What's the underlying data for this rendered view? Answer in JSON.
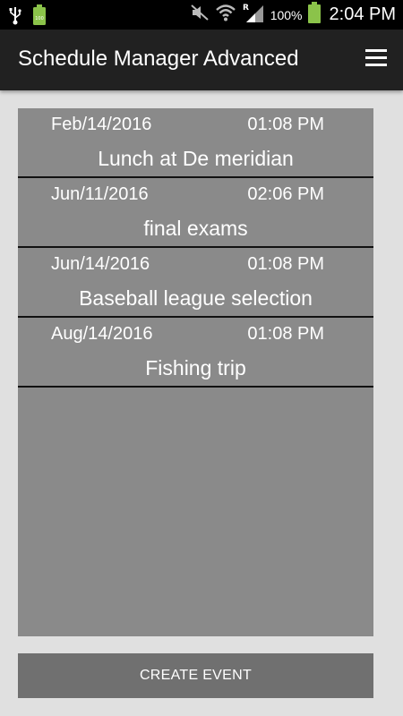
{
  "status_bar": {
    "battery_percent": "100%",
    "time": "2:04 PM",
    "icons": [
      "usb-icon",
      "battery-notification-icon",
      "mute-icon",
      "wifi-icon",
      "signal-icon",
      "battery-icon"
    ],
    "battery_color": "#8bc34a"
  },
  "app_bar": {
    "title": "Schedule Manager Advanced",
    "menu_icon": "hamburger-menu-icon",
    "background": "#212121"
  },
  "events": [
    {
      "date": "Feb/14/2016",
      "time": "01:08 PM",
      "title": "Lunch at De meridian"
    },
    {
      "date": "Jun/11/2016",
      "time": "02:06 PM",
      "title": "final exams"
    },
    {
      "date": "Jun/14/2016",
      "time": "01:08 PM",
      "title": "Baseball league selection"
    },
    {
      "date": "Aug/14/2016",
      "time": "01:08 PM",
      "title": "Fishing trip"
    }
  ],
  "create_button": {
    "label": "CREATE EVENT"
  }
}
